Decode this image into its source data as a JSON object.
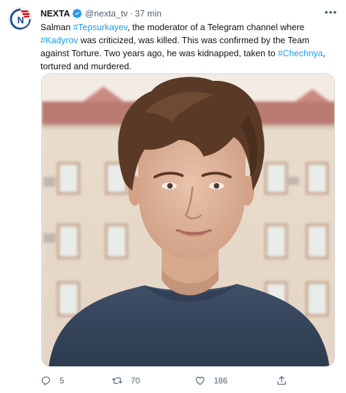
{
  "tweet": {
    "display_name": "NEXTA",
    "handle": "@nexta_tv",
    "separator": "·",
    "time": "37 min",
    "text": {
      "part1": "Salman ",
      "hashtag1": "#Tepsurkayev",
      "part2": ", the moderator of a Telegram channel where ",
      "hashtag2": "#Kadyrov",
      "part3": " was criticized, was killed. This was confirmed by the Team against Torture. Two years ago, he was kidnapped, taken to ",
      "hashtag3": "#Chechnya",
      "part4": ", tortured and murdered."
    }
  },
  "actions": {
    "replies": "5",
    "retweets": "70",
    "likes": "186"
  },
  "icons": {
    "avatar": "nexta-logo",
    "verified": "verified-badge-icon",
    "more": "more-icon",
    "reply": "reply-icon",
    "retweet": "retweet-icon",
    "like": "heart-icon",
    "share": "share-icon"
  },
  "colors": {
    "accent": "#1d9bf0",
    "text": "#0f1419",
    "muted": "#536471",
    "logo_red": "#d6202a",
    "logo_blue": "#1b4a8c"
  }
}
